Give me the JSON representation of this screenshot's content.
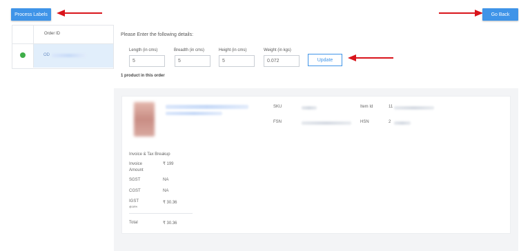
{
  "header": {
    "process_labels": "Process Labels",
    "go_back": "Go Back"
  },
  "sidebar": {
    "column_header": "Order ID",
    "order_prefix": "OD"
  },
  "form": {
    "prompt": "Please Enter the following details:",
    "length_label": "Length (in cms)",
    "length_value": "5",
    "breadth_label": "Breadth (in cms)",
    "breadth_value": "5",
    "height_label": "Height (in cms)",
    "height_value": "5",
    "weight_label": "Weight (in kgs)",
    "weight_value": "0.072",
    "update_label": "Update"
  },
  "products_count": "1 product in this order",
  "product": {
    "sku_label": "SKU",
    "item_id_label": "Item Id",
    "item_id_prefix": "11",
    "fsn_label": "FSN",
    "hsn_label": "HSN",
    "hsn_prefix": "2"
  },
  "invoice": {
    "title": "Invoice & Tax Breakup",
    "rows": [
      {
        "label": "Invoice Amount",
        "sub": "",
        "value": "₹ 199"
      },
      {
        "label": "SGST",
        "sub": "",
        "value": "NA"
      },
      {
        "label": "CGST",
        "sub": "",
        "value": "NA"
      },
      {
        "label": "IGST",
        "sub": "@18%",
        "value": "₹ 30.36"
      }
    ],
    "total_label": "Total",
    "total_value": "₹ 30.36"
  },
  "colors": {
    "accent": "#3f94e8",
    "arrow": "#d9141b",
    "check": "#3fae49"
  }
}
